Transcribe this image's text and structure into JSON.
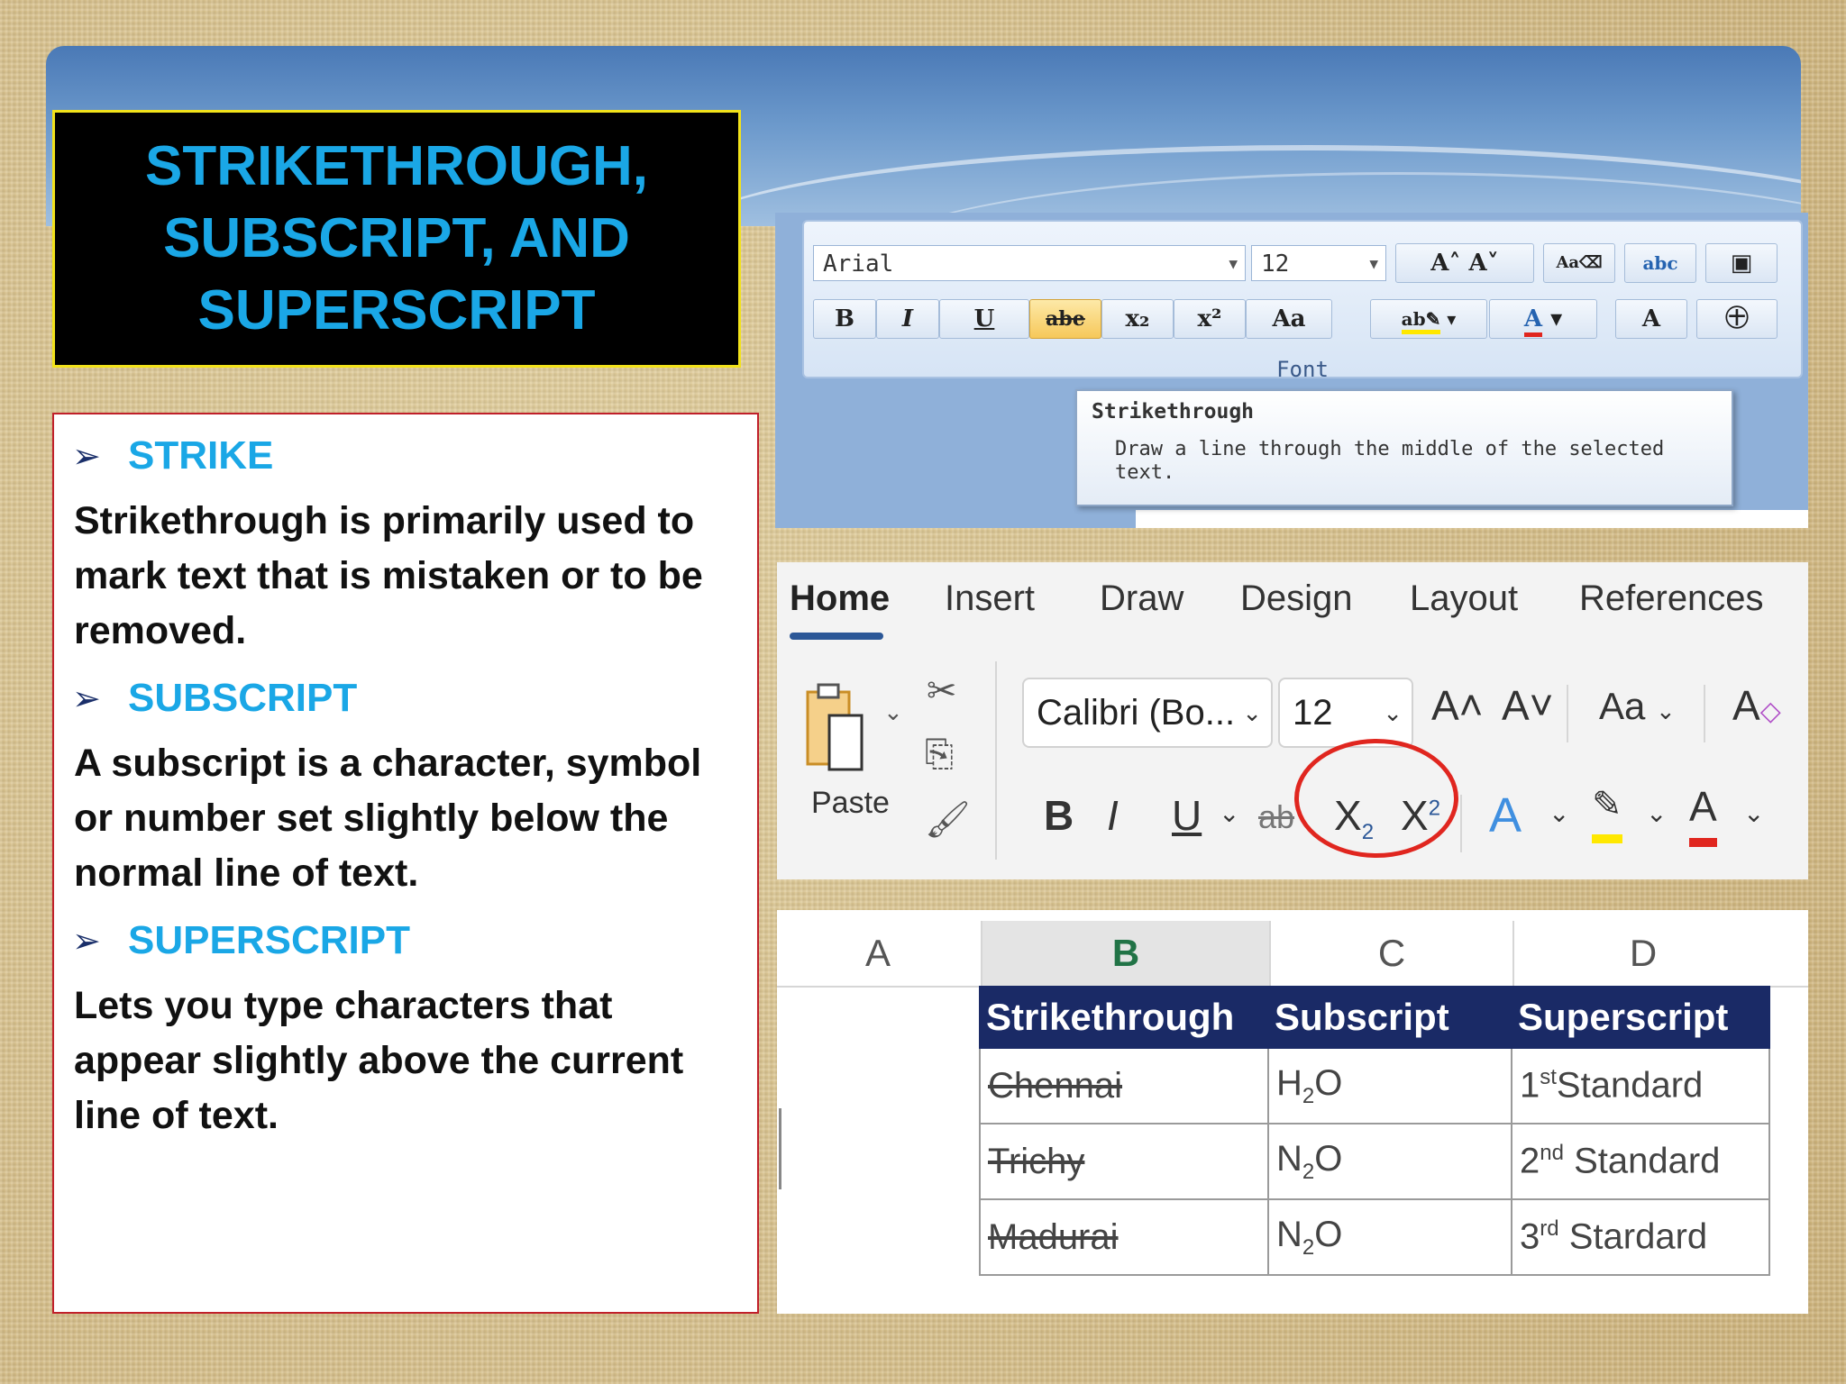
{
  "title": {
    "line1": "STRIKETHROUGH,",
    "line2": "SUBSCRIPT, AND",
    "line3": "SUPERSCRIPT"
  },
  "content": {
    "strike_heading": "STRIKE",
    "strike_text": "Strikethrough is primarily used to mark text that is mistaken or to be removed.",
    "subscript_heading": "SUBSCRIPT",
    "subscript_text": "A subscript is a character, symbol or number set slightly below the normal line of text.",
    "superscript_heading": "SUPERSCRIPT",
    "superscript_text": "Lets you type characters that appear slightly above the current line of text."
  },
  "font_group": {
    "font_name": "Arial",
    "font_size": "12",
    "bold": "B",
    "italic": "I",
    "underline": "U",
    "strike": "abe",
    "subscript": "x₂",
    "superscript": "x²",
    "change_case": "Aa",
    "group_label": "Font",
    "tooltip_title": "Strikethrough",
    "tooltip_body": "Draw a line through the middle of the selected text."
  },
  "ribbon": {
    "tabs": [
      "Home",
      "Insert",
      "Draw",
      "Design",
      "Layout",
      "References"
    ],
    "paste_label": "Paste",
    "font_name": "Calibri (Bo...",
    "font_size": "12",
    "change_case": "Aa",
    "bold": "B",
    "italic": "I",
    "underline": "U",
    "strike": "ab",
    "subscript_base": "X",
    "subscript_mark": "2",
    "superscript_base": "X",
    "superscript_mark": "2",
    "colors": {
      "highlight": "#ffe800",
      "font_color": "#e0261f",
      "accent": "#2b5797"
    }
  },
  "sheet": {
    "columns": [
      "A",
      "B",
      "C",
      "D"
    ],
    "headers": [
      "Strikethrough",
      "Subscript",
      "Superscript"
    ],
    "rows": [
      {
        "strike": "Chennai",
        "sub_a": "H",
        "sub_n": "2",
        "sub_b": "O",
        "sup_n": "1",
        "sup_mark": "st",
        "sup_text": "Standard"
      },
      {
        "strike": "Trichy",
        "sub_a": "N",
        "sub_n": "2",
        "sub_b": "O",
        "sup_n": "2",
        "sup_mark": "nd",
        "sup_text": "Standard"
      },
      {
        "strike": "Madurai",
        "sub_a": "N",
        "sub_n": "2",
        "sub_b": "O",
        "sup_n": "3",
        "sup_mark": "rd",
        "sup_text": "Stardard"
      }
    ]
  }
}
